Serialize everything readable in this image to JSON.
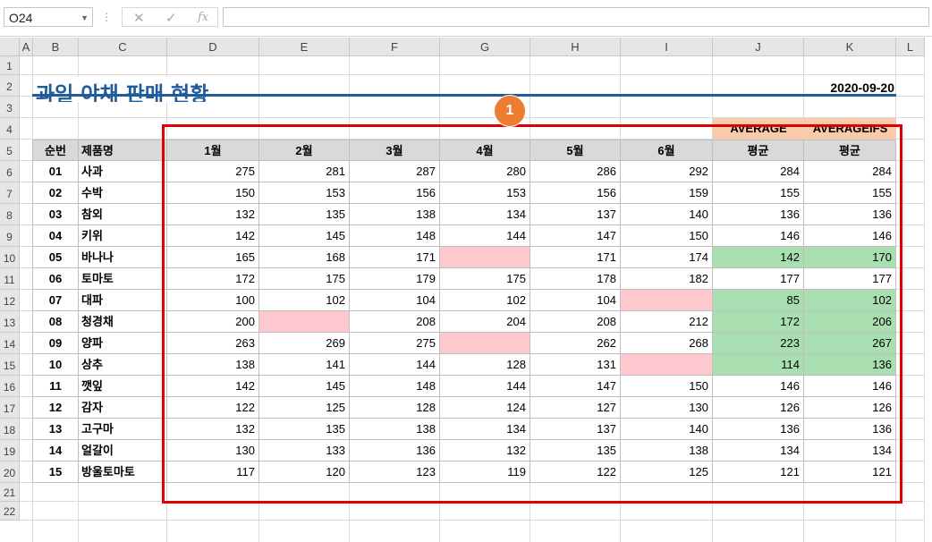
{
  "formula_bar": {
    "name_box": "O24",
    "fx": "fx",
    "cancel": "✕",
    "enter": "✓",
    "formula": ""
  },
  "columns": [
    "A",
    "B",
    "C",
    "D",
    "E",
    "F",
    "G",
    "H",
    "I",
    "J",
    "K",
    "L"
  ],
  "rows": [
    "1",
    "2",
    "3",
    "4",
    "5",
    "6",
    "7",
    "8",
    "9",
    "10",
    "11",
    "12",
    "13",
    "14",
    "15",
    "16",
    "17",
    "18",
    "19",
    "20",
    "21",
    "22"
  ],
  "title": "과일 야채 판매 현황",
  "date": "2020-09-20",
  "callout": "1",
  "func_labels": [
    "AVERAGE",
    "AVERAGEIFS"
  ],
  "table_headers": [
    "순번",
    "제품명",
    "1월",
    "2월",
    "3월",
    "4월",
    "5월",
    "6월",
    "평균",
    "평균"
  ],
  "table_rows": [
    [
      "01",
      "사과",
      "275",
      "281",
      "287",
      "280",
      "286",
      "292",
      "284",
      "284"
    ],
    [
      "02",
      "수박",
      "150",
      "153",
      "156",
      "153",
      "156",
      "159",
      "155",
      "155"
    ],
    [
      "03",
      "참외",
      "132",
      "135",
      "138",
      "134",
      "137",
      "140",
      "136",
      "136"
    ],
    [
      "04",
      "키위",
      "142",
      "145",
      "148",
      "144",
      "147",
      "150",
      "146",
      "146"
    ],
    [
      "05",
      "바나나",
      "165",
      "168",
      "171",
      "",
      "171",
      "174",
      "142",
      "170"
    ],
    [
      "06",
      "토마토",
      "172",
      "175",
      "179",
      "175",
      "178",
      "182",
      "177",
      "177"
    ],
    [
      "07",
      "대파",
      "100",
      "102",
      "104",
      "102",
      "104",
      "",
      "85",
      "102"
    ],
    [
      "08",
      "청경채",
      "200",
      "",
      "208",
      "204",
      "208",
      "212",
      "172",
      "206"
    ],
    [
      "09",
      "양파",
      "263",
      "269",
      "275",
      "",
      "262",
      "268",
      "223",
      "267"
    ],
    [
      "10",
      "상추",
      "138",
      "141",
      "144",
      "128",
      "131",
      "",
      "114",
      "136"
    ],
    [
      "11",
      "깻잎",
      "142",
      "145",
      "148",
      "144",
      "147",
      "150",
      "146",
      "146"
    ],
    [
      "12",
      "감자",
      "122",
      "125",
      "128",
      "124",
      "127",
      "130",
      "126",
      "126"
    ],
    [
      "13",
      "고구마",
      "132",
      "135",
      "138",
      "134",
      "137",
      "140",
      "136",
      "136"
    ],
    [
      "14",
      "얼갈이",
      "130",
      "133",
      "136",
      "132",
      "135",
      "138",
      "134",
      "134"
    ],
    [
      "15",
      "방울토마토",
      "117",
      "120",
      "123",
      "119",
      "122",
      "125",
      "121",
      "121"
    ]
  ],
  "colors": {
    "title": "#1f5c99",
    "highlight_box": "#e00000",
    "callout": "#ed7d31",
    "empty_cell": "#ffc7ce",
    "avg_diff": "#a9dfb0",
    "func_header": "#f8cbad"
  }
}
